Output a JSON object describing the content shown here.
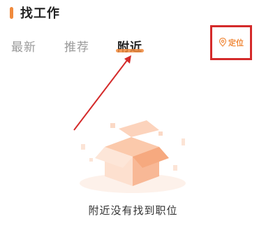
{
  "header": {
    "title": "找工作"
  },
  "tabs": [
    {
      "label": "最新"
    },
    {
      "label": "推荐"
    },
    {
      "label": "附近"
    }
  ],
  "active_tab": "附近",
  "locate": {
    "label": "定位",
    "icon": "location-pin-icon"
  },
  "empty_state": {
    "message": "附近没有找到职位",
    "icon": "open-box-icon"
  },
  "colors": {
    "accent": "#f08a3c",
    "box_light": "#fde0cf",
    "box_mid": "#f8b896",
    "highlight_box": "#d42a2a",
    "arrow": "#d42a2a",
    "text_primary": "#222222",
    "text_muted": "#9a9a9a"
  }
}
